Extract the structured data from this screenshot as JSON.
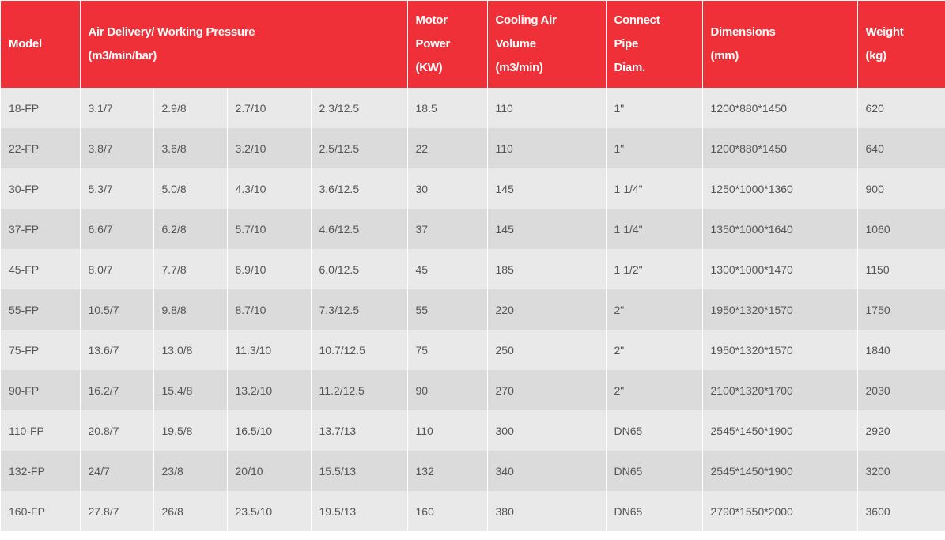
{
  "table": {
    "headers": {
      "model": "Model",
      "air_delivery": [
        "Air Delivery/ Working Pressure",
        "(m3/min/bar)"
      ],
      "motor_power": [
        "Motor",
        "Power",
        "(KW)"
      ],
      "cooling_air": [
        "Cooling Air",
        "Volume",
        "(m3/min)"
      ],
      "connect_pipe": [
        "Connect",
        "Pipe",
        "Diam."
      ],
      "dimensions": [
        "Dimensions",
        "(mm)"
      ],
      "weight": [
        "Weight",
        "(kg)"
      ]
    },
    "rows": [
      [
        "18-FP",
        "3.1/7",
        "2.9/8",
        "2.7/10",
        "2.3/12.5",
        "18.5",
        "110",
        "1\"",
        "1200*880*1450",
        "620"
      ],
      [
        "22-FP",
        "3.8/7",
        "3.6/8",
        "3.2/10",
        "2.5/12.5",
        "22",
        "110",
        "1\"",
        "1200*880*1450",
        "640"
      ],
      [
        "30-FP",
        "5.3/7",
        "5.0/8",
        "4.3/10",
        "3.6/12.5",
        "30",
        "145",
        "1 1/4\"",
        "1250*1000*1360",
        "900"
      ],
      [
        "37-FP",
        "6.6/7",
        "6.2/8",
        "5.7/10",
        "4.6/12.5",
        "37",
        "145",
        "1 1/4\"",
        "1350*1000*1640",
        "1060"
      ],
      [
        "45-FP",
        "8.0/7",
        "7.7/8",
        "6.9/10",
        "6.0/12.5",
        "45",
        "185",
        "1 1/2\"",
        "1300*1000*1470",
        "1150"
      ],
      [
        "55-FP",
        "10.5/7",
        "9.8/8",
        "8.7/10",
        "7.3/12.5",
        "55",
        "220",
        "2\"",
        "1950*1320*1570",
        "1750"
      ],
      [
        "75-FP",
        "13.6/7",
        "13.0/8",
        "11.3/10",
        "10.7/12.5",
        "75",
        "250",
        "2\"",
        "1950*1320*1570",
        "1840"
      ],
      [
        "90-FP",
        "16.2/7",
        "15.4/8",
        "13.2/10",
        "11.2/12.5",
        "90",
        "270",
        "2\"",
        "2100*1320*1700",
        "2030"
      ],
      [
        "110-FP",
        "20.8/7",
        "19.5/8",
        "16.5/10",
        "13.7/13",
        "110",
        "300",
        "DN65",
        "2545*1450*1900",
        "2920"
      ],
      [
        "132-FP",
        "24/7",
        "23/8",
        "20/10",
        "15.5/13",
        "132",
        "340",
        "DN65",
        "2545*1450*1900",
        "3200"
      ],
      [
        "160-FP",
        "27.8/7",
        "26/8",
        "23.5/10",
        "19.5/13",
        "160",
        "380",
        "DN65",
        "2790*1550*2000",
        "3600"
      ]
    ]
  },
  "colors": {
    "header_bg": "#ef3038",
    "header_text": "#ffffff",
    "row_light": "#e9e9e9",
    "row_dark": "#dbdbdb",
    "cell_text": "#555555"
  }
}
